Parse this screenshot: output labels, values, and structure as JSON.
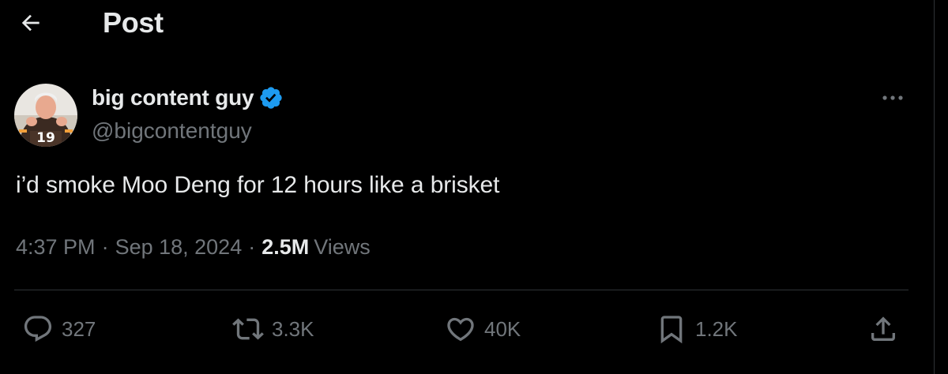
{
  "header": {
    "title": "Post",
    "back_icon": "arrow-left-icon"
  },
  "author": {
    "display_name": "big content guy",
    "handle": "@bigcontentguy",
    "verified": true,
    "verified_color": "#1d9bf0",
    "avatar_jersey_number": "19"
  },
  "post": {
    "text": "i’d smoke Moo Deng for 12 hours like a brisket",
    "time": "4:37 PM",
    "date": "Sep 18, 2024",
    "separator": "·",
    "views_count": "2.5M",
    "views_label": "Views"
  },
  "actions": {
    "replies": "327",
    "reposts": "3.3K",
    "likes": "40K",
    "bookmarks": "1.2K"
  },
  "colors": {
    "background": "#000000",
    "text_primary": "#e7e9ea",
    "text_secondary": "#71767b",
    "border": "#2f3336"
  }
}
